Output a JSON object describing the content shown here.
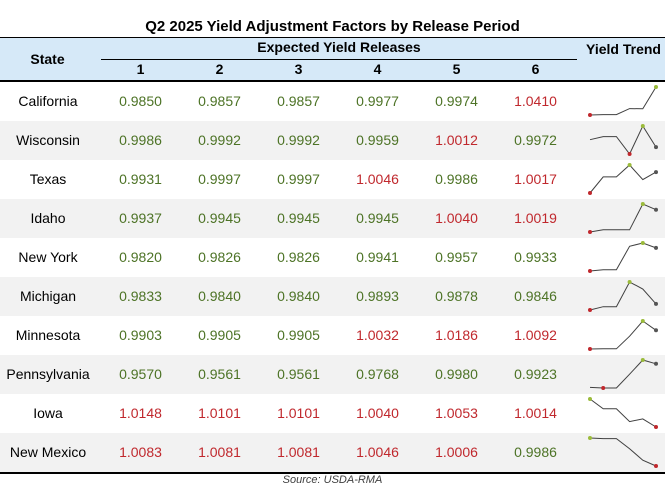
{
  "chart_data": {
    "type": "table",
    "title": "Q2 2025 Yield Adjustment Factors by Release Period",
    "header": {
      "state": "State",
      "group": "Expected Yield Releases",
      "columns": [
        "1",
        "2",
        "3",
        "4",
        "5",
        "6"
      ],
      "trend": "Yield Trend"
    },
    "rows": [
      {
        "state": "California",
        "values": [
          "0.9850",
          "0.9857",
          "0.9857",
          "0.9977",
          "0.9974",
          "1.0410"
        ]
      },
      {
        "state": "Wisconsin",
        "values": [
          "0.9986",
          "0.9992",
          "0.9992",
          "0.9959",
          "1.0012",
          "0.9972"
        ]
      },
      {
        "state": "Texas",
        "values": [
          "0.9931",
          "0.9997",
          "0.9997",
          "1.0046",
          "0.9986",
          "1.0017"
        ]
      },
      {
        "state": "Idaho",
        "values": [
          "0.9937",
          "0.9945",
          "0.9945",
          "0.9945",
          "1.0040",
          "1.0019"
        ]
      },
      {
        "state": "New York",
        "values": [
          "0.9820",
          "0.9826",
          "0.9826",
          "0.9941",
          "0.9957",
          "0.9933"
        ]
      },
      {
        "state": "Michigan",
        "values": [
          "0.9833",
          "0.9840",
          "0.9840",
          "0.9893",
          "0.9878",
          "0.9846"
        ]
      },
      {
        "state": "Minnesota",
        "values": [
          "0.9903",
          "0.9905",
          "0.9905",
          "1.0032",
          "1.0186",
          "1.0092"
        ]
      },
      {
        "state": "Pennsylvania",
        "values": [
          "0.9570",
          "0.9561",
          "0.9561",
          "0.9768",
          "0.9980",
          "0.9923"
        ]
      },
      {
        "state": "Iowa",
        "values": [
          "1.0148",
          "1.0101",
          "1.0101",
          "1.0040",
          "1.0053",
          "1.0014"
        ]
      },
      {
        "state": "New Mexico",
        "values": [
          "1.0083",
          "1.0081",
          "1.0081",
          "1.0046",
          "1.0006",
          "0.9986"
        ]
      }
    ],
    "source": "Source: USDA-RMA"
  },
  "colors": {
    "header_bg": "#d6e9f8",
    "value_below_one": "#4d7326",
    "value_above_one": "#c0282d",
    "trend_line": "#404040",
    "trend_high": "#9bbb3b",
    "trend_low": "#c0282d",
    "trend_last": "#555555",
    "alt_row_bg": "#f2f2f2"
  }
}
